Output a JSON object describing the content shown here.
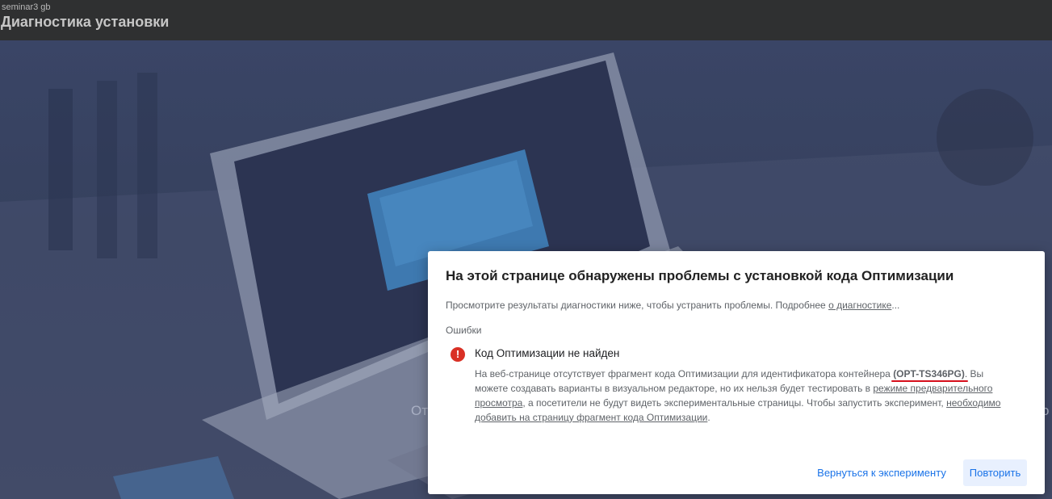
{
  "header": {
    "account": "seminar3 gb",
    "title": "Диагностика установки"
  },
  "background": {
    "text_left": "От",
    "text_right": "о"
  },
  "dialog": {
    "title": "На этой странице обнаружены проблемы с установкой кода Оптимизации",
    "intro": "Просмотрите результаты диагностики ниже, чтобы устранить проблемы. Подробнее ",
    "intro_link": "о диагностике",
    "intro_ellipsis": "...",
    "section_label": "Ошибки",
    "error": {
      "icon": "error-icon",
      "icon_glyph": "!",
      "title": "Код Оптимизации не найден",
      "desc_part1": "На веб-странице отсутствует фрагмент кода Оптимизации для идентификатора контейнера ",
      "container_id": "(OPT-TS346PG)",
      "desc_part2": ". Вы можете создавать варианты в визуальном редакторе, но их нельзя будет тестировать в ",
      "preview_link": "режиме предварительного просмотра",
      "desc_part3": ", а посетители не будут видеть экспериментальные страницы. Чтобы запустить эксперимент, ",
      "add_link": "необходимо добавить на страницу фрагмент кода Оптимизации",
      "desc_end": "."
    },
    "buttons": {
      "back": "Вернуться к эксперименту",
      "retry": "Повторить"
    }
  },
  "colors": {
    "error": "#d93025",
    "accent": "#1a73e8",
    "highlight_underline": "#d60f1c"
  }
}
